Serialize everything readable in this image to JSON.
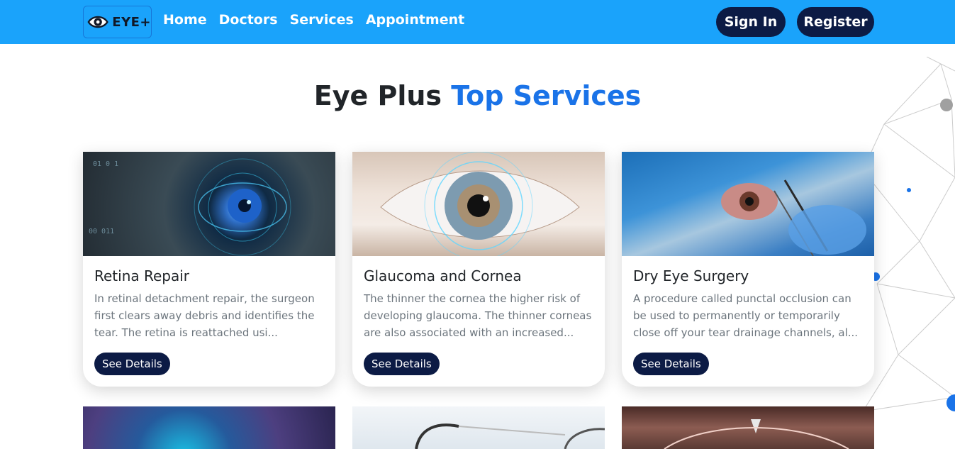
{
  "nav": {
    "logo_text": "EYE+",
    "links": [
      "Home",
      "Doctors",
      "Services",
      "Appointment"
    ],
    "sign_in": "Sign In",
    "register": "Register"
  },
  "heading": {
    "part1": "Eye Plus ",
    "part2": "Top Services"
  },
  "services": [
    {
      "title": "Retina Repair",
      "description": "In retinal detachment repair, the surgeon first clears away debris and identifies the tear. The retina is reattached usi...",
      "button": "See Details"
    },
    {
      "title": "Glaucoma and Cornea",
      "description": "The thinner the cornea the higher risk of developing glaucoma. The thinner corneas are also associated with an increased...",
      "button": "See Details"
    },
    {
      "title": "Dry Eye Surgery",
      "description": "A procedure called punctal occlusion can be used to permanently or temporarily close off your tear drainage channels, al...",
      "button": "See Details"
    }
  ],
  "colors": {
    "navbar": "#1aa3fb",
    "button_dark": "#0c1b45",
    "accent": "#1a73e8"
  }
}
